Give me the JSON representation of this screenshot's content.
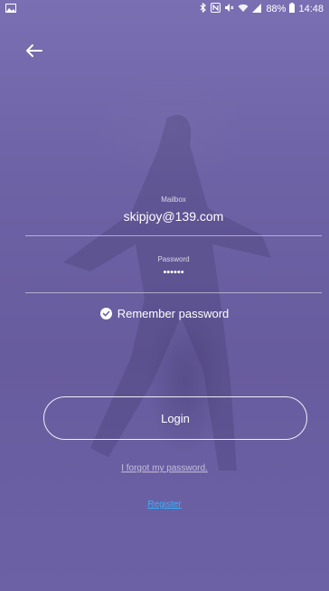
{
  "status": {
    "bluetooth_icon": "bluetooth-icon",
    "nfc_icon": "nfc-icon",
    "mute_icon": "mute-icon",
    "wifi_icon": "wifi-icon",
    "signal_icon": "signal-icon",
    "battery_text": "88%",
    "time": "14:48"
  },
  "login": {
    "mailbox_label": "Mailbox",
    "mailbox_value": "skipjoy@139.com",
    "password_label": "Password",
    "password_value": "••••••",
    "remember_text": "Remember password",
    "login_button": "Login",
    "forgot_link": "I forgot my password.",
    "register_link": "Register"
  },
  "colors": {
    "background": "#6e63a6",
    "register_link": "#31b6ff"
  }
}
